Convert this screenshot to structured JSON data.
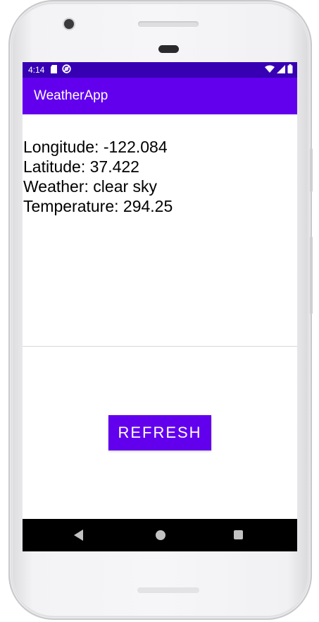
{
  "status_bar": {
    "time": "4:14",
    "left_icons": [
      "sd-card-icon",
      "sync-icon"
    ],
    "right_icons": [
      "wifi-icon",
      "signal-icon",
      "battery-icon"
    ]
  },
  "app_bar": {
    "title": "WeatherApp"
  },
  "weather_info": {
    "longitude": "Longitude: -122.084",
    "latitude": "Latitude: 37.422",
    "weather": "Weather: clear sky",
    "temperature": "Temperature: 294.25"
  },
  "actions": {
    "refresh_label": "REFRESH"
  },
  "navigation": {
    "icons": [
      "back-icon",
      "home-icon",
      "recents-icon"
    ]
  },
  "colors": {
    "status_bar": "#3700b3",
    "primary": "#6200ee",
    "nav_bar": "#000000",
    "text": "#000000"
  }
}
